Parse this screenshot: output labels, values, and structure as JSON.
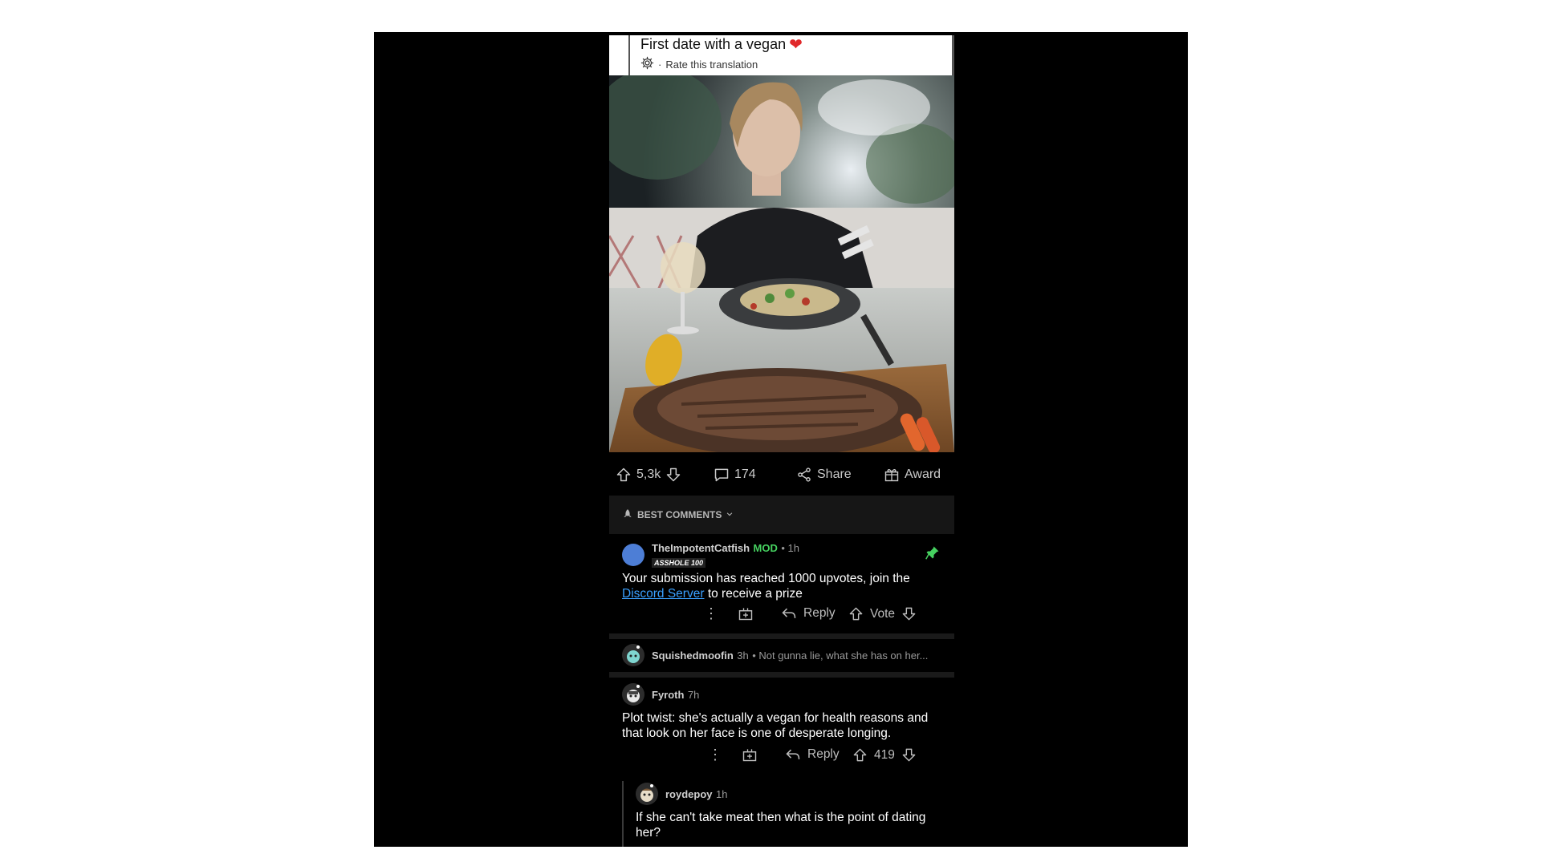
{
  "post": {
    "title": "First date with a vegan",
    "rate_translation": "Rate this translation"
  },
  "actions": {
    "upvotes": "5,3k",
    "comments": "174",
    "share": "Share",
    "award": "Award"
  },
  "sort": {
    "label": "BEST COMMENTS"
  },
  "comments": [
    {
      "username": "TheImpotentCatfish",
      "badge": "MOD",
      "time": "• 1h",
      "flair": "ASSHOLE 100",
      "body_before": "Your submission has reached 1000 upvotes, join the",
      "link": "Discord Server",
      "body_after": "to receive a prize",
      "reply": "Reply",
      "vote": "Vote"
    },
    {
      "username": "Squishedmoofin",
      "time": "3h",
      "preview": "• Not gunna lie, what she has on her..."
    },
    {
      "username": "Fyroth",
      "time": "7h",
      "body": "Plot twist: she's actually a vegan for health reasons and that look on her face is one of desperate longing.",
      "reply": "Reply",
      "score": "419"
    },
    {
      "username": "roydepoy",
      "time": "1h",
      "body": "If she can't take meat then what is the point of dating her?"
    }
  ],
  "colors": {
    "mod": "#46d160",
    "link": "#3aa0ff",
    "heart": "#e0282a",
    "pin": "#46d160"
  }
}
